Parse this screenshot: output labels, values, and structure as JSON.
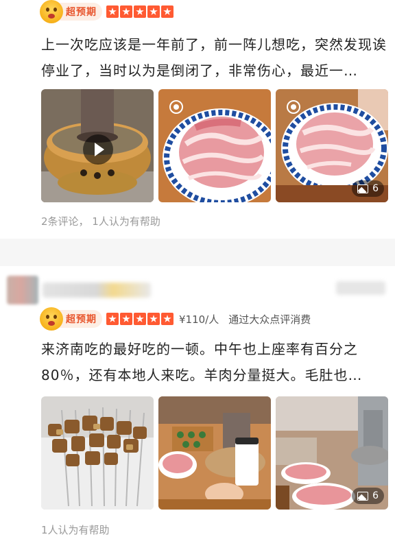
{
  "reviews": [
    {
      "badge_label": "超预期",
      "stars": 5,
      "text": "上一次吃应该是一年前了，前一阵儿想吃，突然发现诶停业了，当时以为是倒闭了，非常伤心，最近一…",
      "photos": [
        {
          "name": "hotpot-video",
          "has_play": true
        },
        {
          "name": "lamb-slices-plate"
        },
        {
          "name": "lamb-slices-plate-2",
          "count": "6"
        }
      ],
      "meta": "2条评论，  1人认为有帮助"
    },
    {
      "badge_label": "超预期",
      "stars": 5,
      "price": "¥110/人",
      "consume_note": "通过大众点评消费",
      "text": "来济南吃的最好吃的一顿。中午也上座率有百分之80％，还有本地人来吃。羊肉分量挺大。毛肚也…",
      "photos": [
        {
          "name": "lamb-skewers"
        },
        {
          "name": "table-spread-drink"
        },
        {
          "name": "hotpot-table",
          "count": "6"
        }
      ],
      "meta": "1人认为有帮助"
    }
  ],
  "colors": {
    "accent": "#ff5a32",
    "badge_text": "#e8562d",
    "muted": "#999999"
  }
}
